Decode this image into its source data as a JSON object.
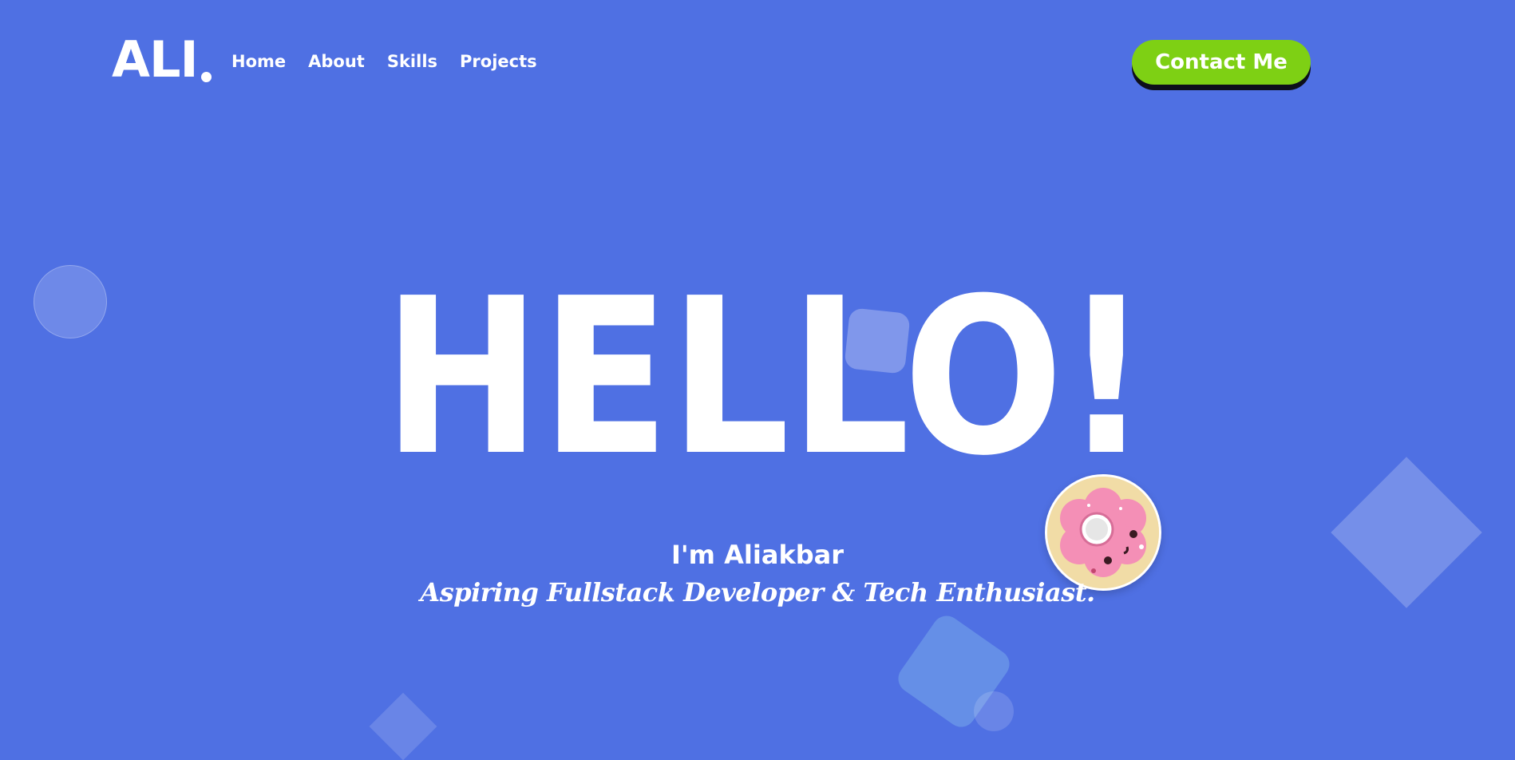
{
  "header": {
    "logo_text": "ALI",
    "nav": [
      {
        "label": "Home"
      },
      {
        "label": "About"
      },
      {
        "label": "Skills"
      },
      {
        "label": "Projects"
      }
    ],
    "contact_label": "Contact Me"
  },
  "hero": {
    "title": "HELLO!",
    "name": "I'm Aliakbar",
    "tagline": "Aspiring Fullstack Developer & Tech Enthusiast."
  },
  "colors": {
    "background": "#4f70e3",
    "accent_button": "#7ed014",
    "text": "#ffffff"
  },
  "icons": {
    "avatar": "donut-avatar"
  }
}
